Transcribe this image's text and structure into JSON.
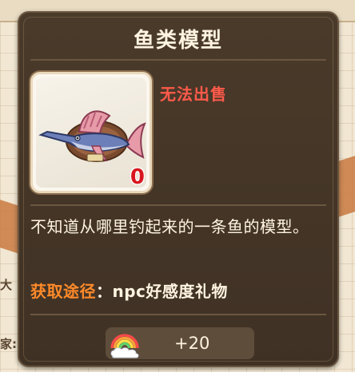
{
  "item": {
    "title": "鱼类模型",
    "sell_status": "无法出售",
    "count": "0",
    "icon": "mounted-swordfish-icon",
    "description": "不知道从哪里钓起来的一条鱼的模型。",
    "source_label": "获取途径",
    "source_separator": "：",
    "source_value": "npc好感度礼物",
    "reward": {
      "icon": "rainbow-cloud-icon",
      "value": "+20"
    }
  },
  "background": {
    "partial_text_1": "大",
    "partial_text_2": "家:"
  },
  "colors": {
    "panel_bg": "#43352a",
    "title": "#fff4e0",
    "unsellable": "#ff5a4a",
    "source_label": "#ff8a2a",
    "count": "#d8161f"
  }
}
